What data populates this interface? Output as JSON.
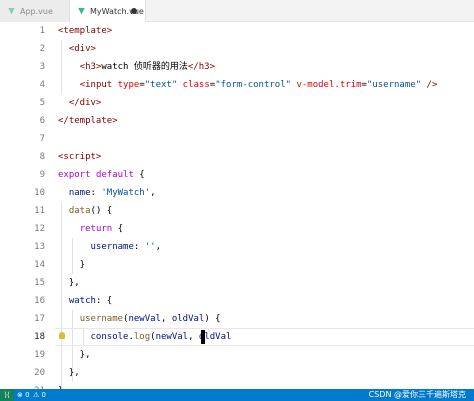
{
  "tabs": [
    {
      "label": "App.vue",
      "active": false
    },
    {
      "label": "MyWatch.vue",
      "active": true,
      "dirty": true
    }
  ],
  "editor": {
    "current_line": 18,
    "lines": [
      {
        "num": "1",
        "tokens": [
          {
            "t": "<template>",
            "c": "tag"
          }
        ]
      },
      {
        "num": "2",
        "tokens": [
          {
            "t": "  "
          },
          {
            "t": "<div>",
            "c": "tag"
          }
        ]
      },
      {
        "num": "3",
        "tokens": [
          {
            "t": "    "
          },
          {
            "t": "<h3>",
            "c": "tag"
          },
          {
            "t": "watch 侦听器的用法",
            "c": "text"
          },
          {
            "t": "</h3>",
            "c": "tag"
          }
        ]
      },
      {
        "num": "4",
        "tokens": [
          {
            "t": "    "
          },
          {
            "t": "<input",
            "c": "tag"
          },
          {
            "t": " "
          },
          {
            "t": "type",
            "c": "attr"
          },
          {
            "t": "="
          },
          {
            "t": "\"text\"",
            "c": "str"
          },
          {
            "t": " "
          },
          {
            "t": "class",
            "c": "attr"
          },
          {
            "t": "="
          },
          {
            "t": "\"form-control\"",
            "c": "str"
          },
          {
            "t": " "
          },
          {
            "t": "v-model.trim",
            "c": "attr"
          },
          {
            "t": "="
          },
          {
            "t": "\"username\"",
            "c": "str"
          },
          {
            "t": " "
          },
          {
            "t": "/>",
            "c": "tag"
          }
        ]
      },
      {
        "num": "5",
        "tokens": [
          {
            "t": "  "
          },
          {
            "t": "</div>",
            "c": "tag"
          }
        ]
      },
      {
        "num": "6",
        "tokens": [
          {
            "t": "</template>",
            "c": "tag"
          }
        ]
      },
      {
        "num": "7",
        "tokens": []
      },
      {
        "num": "8",
        "tokens": [
          {
            "t": "<script>",
            "c": "tag"
          }
        ]
      },
      {
        "num": "9",
        "tokens": [
          {
            "t": "export",
            "c": "ctl"
          },
          {
            "t": " "
          },
          {
            "t": "default",
            "c": "ctl"
          },
          {
            "t": " {"
          }
        ]
      },
      {
        "num": "10",
        "tokens": [
          {
            "t": "  "
          },
          {
            "t": "name",
            "c": "prop"
          },
          {
            "t": ": "
          },
          {
            "t": "'MyWatch'",
            "c": "str"
          },
          {
            "t": ","
          }
        ]
      },
      {
        "num": "11",
        "tokens": [
          {
            "t": "  "
          },
          {
            "t": "data",
            "c": "fn"
          },
          {
            "t": "() {"
          }
        ]
      },
      {
        "num": "12",
        "tokens": [
          {
            "t": "    "
          },
          {
            "t": "return",
            "c": "ctl"
          },
          {
            "t": " {"
          }
        ]
      },
      {
        "num": "13",
        "tokens": [
          {
            "t": "      "
          },
          {
            "t": "username",
            "c": "prop"
          },
          {
            "t": ": "
          },
          {
            "t": "''",
            "c": "str"
          },
          {
            "t": ","
          }
        ]
      },
      {
        "num": "14",
        "tokens": [
          {
            "t": "    }"
          }
        ]
      },
      {
        "num": "15",
        "tokens": [
          {
            "t": "  },"
          }
        ]
      },
      {
        "num": "16",
        "tokens": [
          {
            "t": "  "
          },
          {
            "t": "watch",
            "c": "prop"
          },
          {
            "t": ": {"
          }
        ]
      },
      {
        "num": "17",
        "tokens": [
          {
            "t": "    "
          },
          {
            "t": "username",
            "c": "fn"
          },
          {
            "t": "("
          },
          {
            "t": "newVal",
            "c": "var"
          },
          {
            "t": ", "
          },
          {
            "t": "oldVal",
            "c": "var"
          },
          {
            "t": ") {"
          }
        ]
      },
      {
        "num": "18",
        "tokens": [
          {
            "t": "      "
          },
          {
            "t": "console",
            "c": "var"
          },
          {
            "t": "."
          },
          {
            "t": "log",
            "c": "fn"
          },
          {
            "t": "("
          },
          {
            "t": "newVal",
            "c": "var"
          },
          {
            "t": ", "
          },
          {
            "t": "oldVal",
            "c": "var"
          }
        ]
      },
      {
        "num": "19",
        "tokens": [
          {
            "t": "    },"
          }
        ]
      },
      {
        "num": "20",
        "tokens": [
          {
            "t": "  },"
          }
        ]
      },
      {
        "num": "21",
        "tokens": [
          {
            "t": "}"
          }
        ]
      }
    ]
  },
  "statusbar": {
    "remote_icon": "remote-icon",
    "errors": "⊗ 0",
    "warnings": "⚠ 0",
    "watermark": "CSDN @爱你三千遍斯塔克"
  },
  "colors": {
    "tag": "#800000",
    "attr": "#e50000",
    "str": "#0451a5",
    "ctl": "#af00db",
    "prop": "#001080",
    "fn": "#795e26",
    "var": "#001080",
    "statusbar_bg": "#007acc"
  }
}
